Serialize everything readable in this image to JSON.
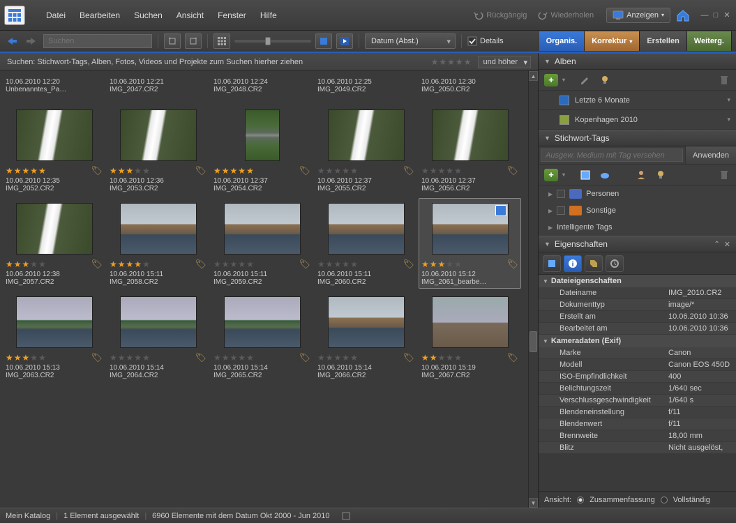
{
  "menubar": {
    "items": [
      "Datei",
      "Bearbeiten",
      "Suchen",
      "Ansicht",
      "Fenster",
      "Hilfe"
    ],
    "undo": "Rückgängig",
    "redo": "Wiederholen",
    "display": "Anzeigen"
  },
  "toolbar": {
    "search_placeholder": "Suchen",
    "sort": "Datum (Abst.)",
    "details": "Details",
    "tabs": {
      "organise": "Organis.",
      "korrektur": "Korrektur",
      "erstellen": "Erstellen",
      "weiterg": "Weiterg."
    }
  },
  "searchbar": {
    "text": "Suchen: Stichwort-Tags, Alben, Fotos, Videos und Projekte zum Suchen hierher ziehen",
    "filter": "und höher"
  },
  "thumbs": [
    {
      "no_img": true,
      "date": "10.06.2010 12:20",
      "name": "Unbenanntes_Pa…"
    },
    {
      "no_img": true,
      "date": "10.06.2010 12:21",
      "name": "IMG_2047.CR2"
    },
    {
      "no_img": true,
      "date": "10.06.2010 12:24",
      "name": "IMG_2048.CR2"
    },
    {
      "no_img": true,
      "date": "10.06.2010 12:25",
      "name": "IMG_2049.CR2"
    },
    {
      "no_img": true,
      "date": "10.06.2010 12:30",
      "name": "IMG_2050.CR2"
    },
    {
      "cls": "waterfall",
      "stars": 5,
      "date": "10.06.2010 12:35",
      "name": "IMG_2052.CR2"
    },
    {
      "cls": "waterfall",
      "stars": 3,
      "date": "10.06.2010 12:36",
      "name": "IMG_2053.CR2"
    },
    {
      "cls": "stream",
      "portrait": true,
      "stars": 5,
      "date": "10.06.2010 12:37",
      "name": "IMG_2054.CR2"
    },
    {
      "cls": "waterfall",
      "stars": 0,
      "date": "10.06.2010 12:37",
      "name": "IMG_2055.CR2"
    },
    {
      "cls": "waterfall",
      "stars": 0,
      "date": "10.06.2010 12:37",
      "name": "IMG_2056.CR2"
    },
    {
      "cls": "waterfall",
      "stars": 3,
      "date": "10.06.2010 12:38",
      "name": "IMG_2057.CR2"
    },
    {
      "cls": "city",
      "stars": 4,
      "date": "10.06.2010 15:11",
      "name": "IMG_2058.CR2"
    },
    {
      "cls": "city",
      "stars": 0,
      "date": "10.06.2010 15:11",
      "name": "IMG_2059.CR2"
    },
    {
      "cls": "city",
      "stars": 0,
      "date": "10.06.2010 15:11",
      "name": "IMG_2060.CR2"
    },
    {
      "cls": "city",
      "stars": 3,
      "date": "10.06.2010 15:12",
      "name": "IMG_2061_bearbe…",
      "selected": true,
      "badge": true
    },
    {
      "cls": "city2",
      "stars": 3,
      "date": "10.06.2010 15:13",
      "name": "IMG_2063.CR2"
    },
    {
      "cls": "city2",
      "stars": 0,
      "date": "10.06.2010 15:14",
      "name": "IMG_2064.CR2"
    },
    {
      "cls": "city2",
      "stars": 0,
      "date": "10.06.2010 15:14",
      "name": "IMG_2065.CR2"
    },
    {
      "cls": "city",
      "stars": 0,
      "date": "10.06.2010 15:14",
      "name": "IMG_2066.CR2"
    },
    {
      "cls": "crowd",
      "stars": 2,
      "date": "10.06.2010 15:19",
      "name": "IMG_2067.CR2"
    }
  ],
  "panels": {
    "alben": {
      "title": "Alben",
      "items": [
        {
          "color": "#2a6ac0",
          "label": "Letzte 6 Monate"
        },
        {
          "color": "#8aa040",
          "label": "Kopenhagen 2010"
        }
      ]
    },
    "tags": {
      "title": "Stichwort-Tags",
      "placeholder": "Ausgew. Medium mit Tag versehen",
      "apply": "Anwenden",
      "items": [
        {
          "icon": "person",
          "label": "Personen",
          "expandable": true
        },
        {
          "icon": "other",
          "label": "Sonstige",
          "expandable": true
        },
        {
          "label": "Intelligente Tags",
          "expandable": true
        }
      ]
    },
    "props": {
      "title": "Eigenschaften",
      "groups": [
        {
          "name": "Dateieigenschaften",
          "rows": [
            {
              "k": "Dateiname",
              "v": "IMG_2010.CR2"
            },
            {
              "k": "Dokumenttyp",
              "v": "image/*"
            },
            {
              "k": "Erstellt am",
              "v": "10.06.2010 10:36"
            },
            {
              "k": "Bearbeitet am",
              "v": "10.06.2010 10:36"
            }
          ]
        },
        {
          "name": "Kameradaten (Exif)",
          "rows": [
            {
              "k": "Marke",
              "v": "Canon"
            },
            {
              "k": "Modell",
              "v": "Canon EOS 450D"
            },
            {
              "k": "ISO-Empfindlichkeit",
              "v": "400"
            },
            {
              "k": "Belichtungszeit",
              "v": "1/640 sec"
            },
            {
              "k": "Verschlussgeschwindigkeit",
              "v": "1/640 s"
            },
            {
              "k": "Blendeneinstellung",
              "v": "f/11"
            },
            {
              "k": "Blendenwert",
              "v": "f/11"
            },
            {
              "k": "Brennweite",
              "v": "18,00 mm"
            },
            {
              "k": "Blitz",
              "v": "Nicht ausgelöst,"
            }
          ]
        }
      ],
      "footer": {
        "label": "Ansicht:",
        "opt1": "Zusammenfassung",
        "opt2": "Vollständig"
      }
    }
  },
  "statusbar": {
    "catalog": "Mein Katalog",
    "selection": "1 Element ausgewählt",
    "count": "6960 Elemente mit dem Datum Okt 2000 - Jun 2010"
  }
}
